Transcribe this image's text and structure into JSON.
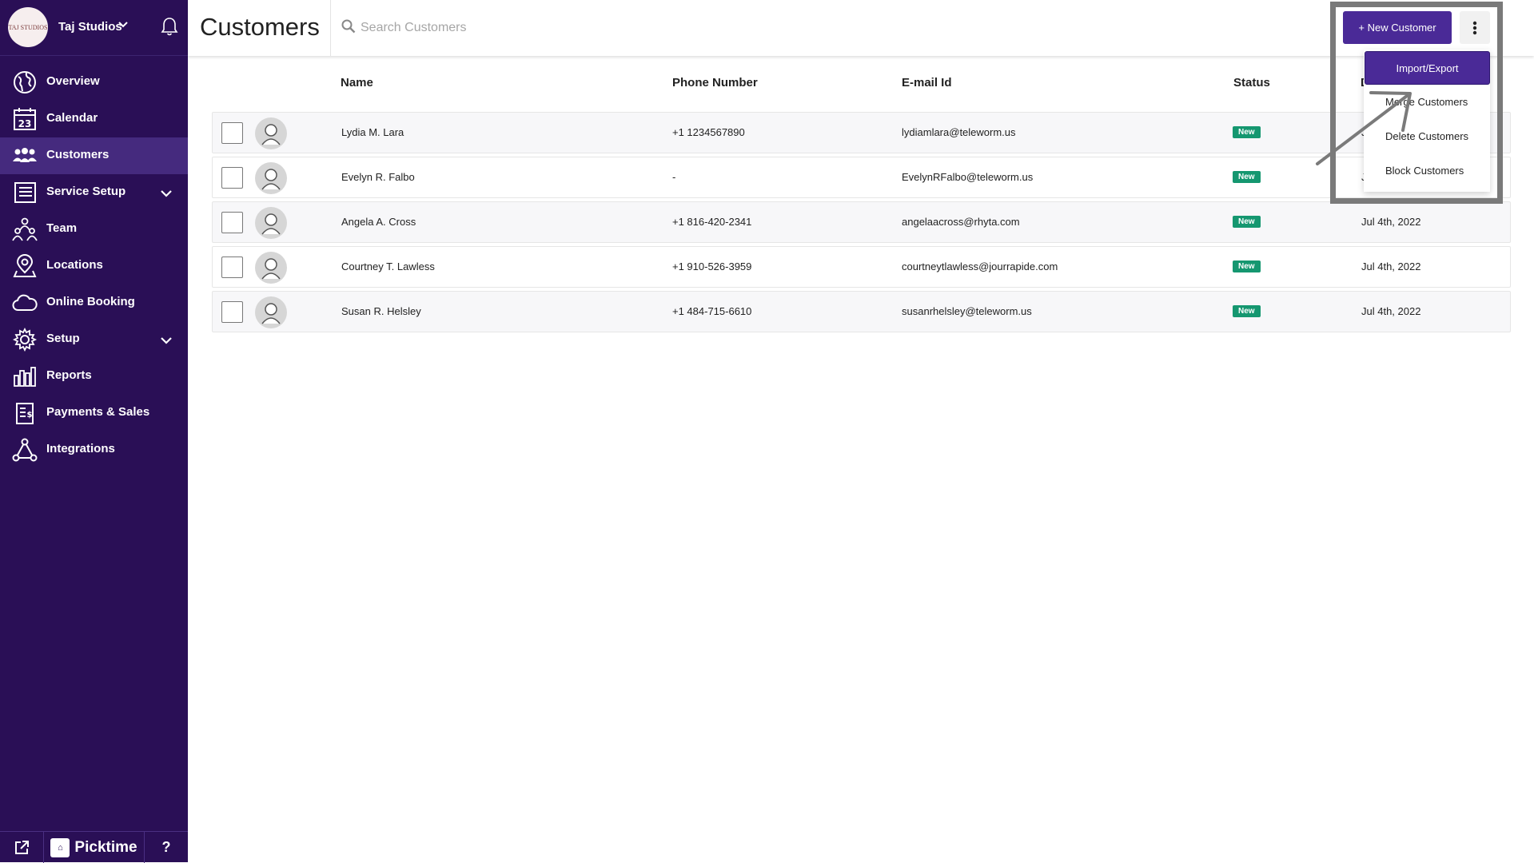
{
  "brand": {
    "logo_text": "TAJ STUDIOS",
    "name": "Taj Studios"
  },
  "sidebar": {
    "items": [
      {
        "label": "Overview",
        "icon": "globe-icon"
      },
      {
        "label": "Calendar",
        "icon": "calendar-icon",
        "day": "23"
      },
      {
        "label": "Customers",
        "icon": "customers-icon",
        "active": true
      },
      {
        "label": "Service Setup",
        "icon": "service-setup-icon",
        "expandable": true
      },
      {
        "label": "Team",
        "icon": "team-icon"
      },
      {
        "label": "Locations",
        "icon": "location-pin-icon"
      },
      {
        "label": "Online Booking",
        "icon": "cloud-icon"
      },
      {
        "label": "Setup",
        "icon": "gear-icon",
        "expandable": true
      },
      {
        "label": "Reports",
        "icon": "bar-chart-icon"
      },
      {
        "label": "Payments & Sales",
        "icon": "receipt-icon"
      },
      {
        "label": "Integrations",
        "icon": "integrations-icon"
      }
    ],
    "footer": {
      "brand": "Picktime",
      "help": "?"
    }
  },
  "header": {
    "title": "Customers",
    "search_placeholder": "Search Customers",
    "new_button": "+ New Customer"
  },
  "dropdown": {
    "items": [
      "Import/Export",
      "Merge Customers",
      "Delete Customers",
      "Block Customers"
    ]
  },
  "table": {
    "columns": [
      "Name",
      "Phone Number",
      "E-mail Id",
      "Status",
      "D"
    ],
    "rows": [
      {
        "name": "Lydia M. Lara",
        "phone": "+1 1234567890",
        "email": "lydiamlara@teleworm.us",
        "status": "New",
        "date": "J"
      },
      {
        "name": "Evelyn R. Falbo",
        "phone": "-",
        "email": "EvelynRFalbo@teleworm.us",
        "status": "New",
        "date": "J"
      },
      {
        "name": "Angela A. Cross",
        "phone": "+1 816-420-2341",
        "email": "angelaacross@rhyta.com",
        "status": "New",
        "date": "Jul 4th, 2022"
      },
      {
        "name": "Courtney T. Lawless",
        "phone": "+1 910-526-3959",
        "email": "courtneytlawless@jourrapide.com",
        "status": "New",
        "date": "Jul 4th, 2022"
      },
      {
        "name": "Susan R. Helsley",
        "phone": "+1 484-715-6610",
        "email": "susanrhelsley@teleworm.us",
        "status": "New",
        "date": "Jul 4th, 2022"
      }
    ]
  },
  "colors": {
    "sidebar": "#2a0f56",
    "accent": "#4a2a97",
    "badge": "#159770"
  }
}
